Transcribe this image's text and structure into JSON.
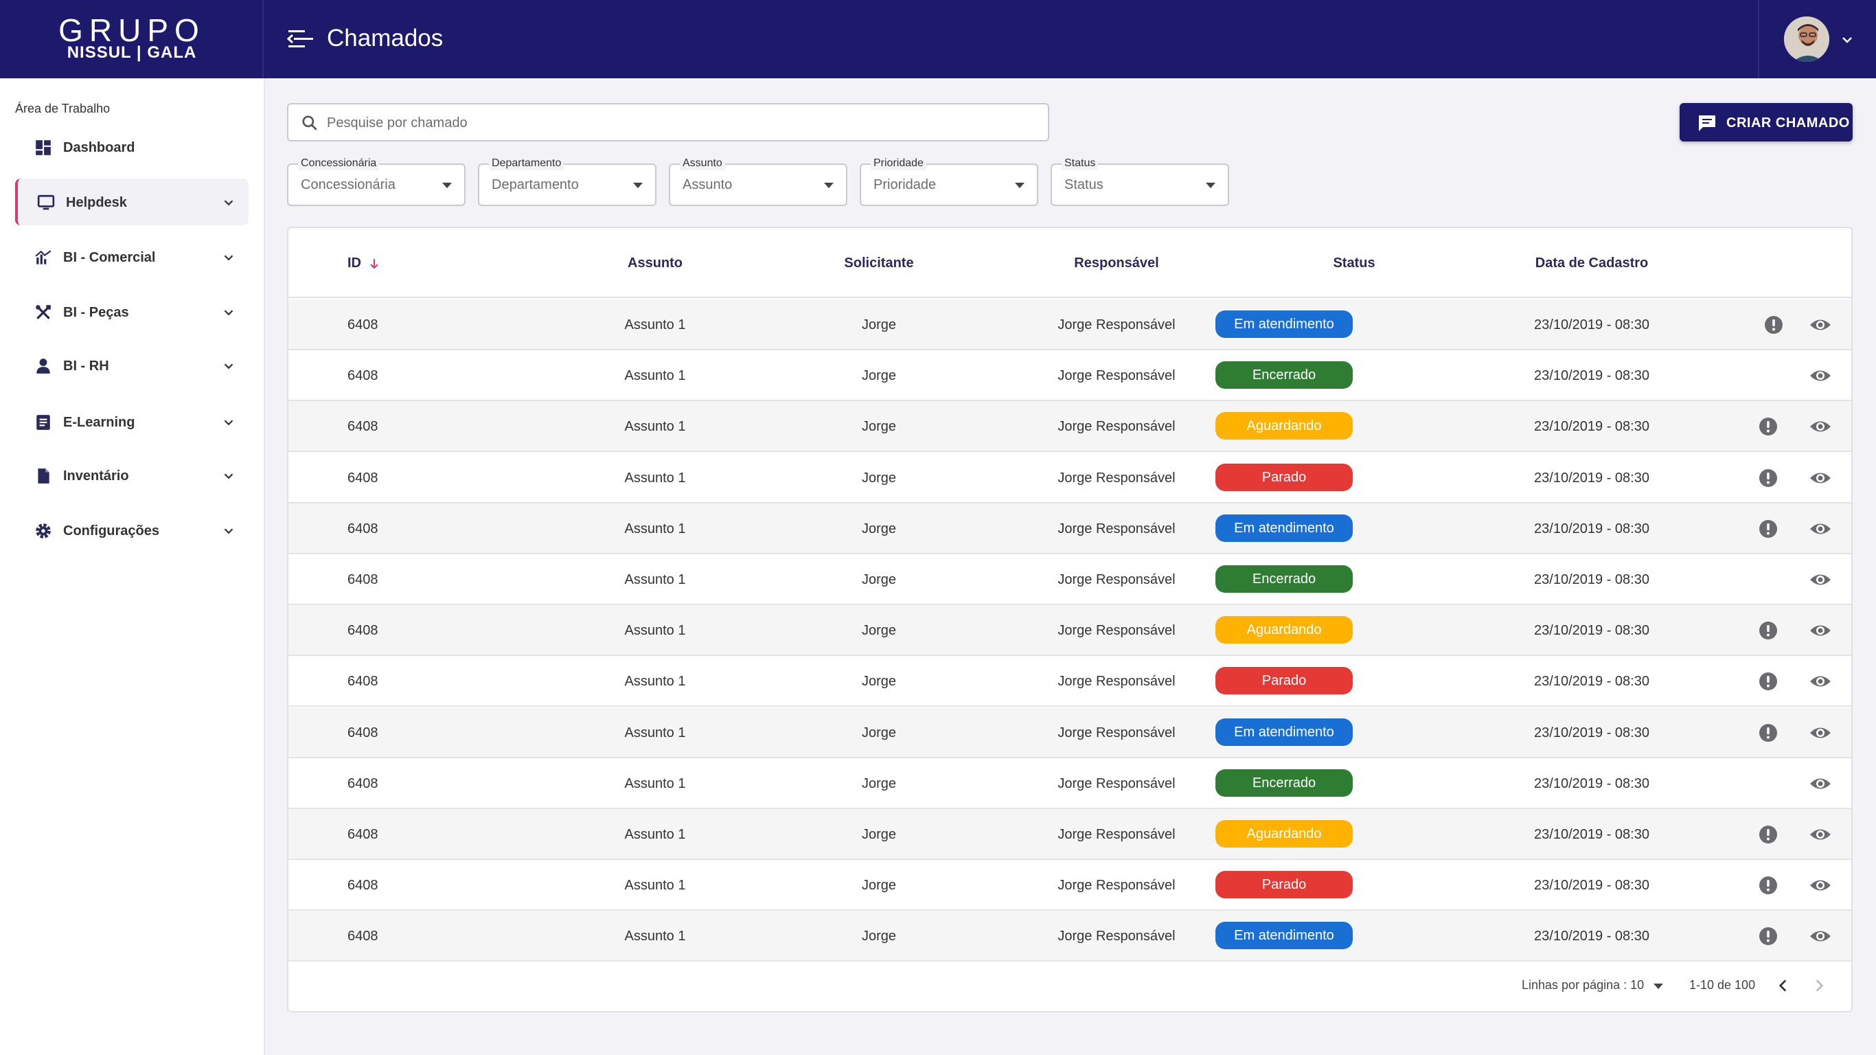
{
  "brand": {
    "line1": "GRUPO",
    "line2": "NISSUL | GALA"
  },
  "header": {
    "title": "Chamados"
  },
  "sidebar": {
    "section": "Área de Trabalho",
    "items": [
      {
        "label": "Dashboard",
        "icon": "dashboard-icon"
      },
      {
        "label": "Helpdesk",
        "icon": "monitor-icon"
      },
      {
        "label": "BI - Comercial",
        "icon": "chart-icon"
      },
      {
        "label": "BI - Peças",
        "icon": "tools-icon"
      },
      {
        "label": "BI - RH",
        "icon": "person-icon"
      },
      {
        "label": "E-Learning",
        "icon": "book-icon"
      },
      {
        "label": "Inventário",
        "icon": "document-icon"
      },
      {
        "label": "Configurações",
        "icon": "gear-icon"
      }
    ]
  },
  "search": {
    "placeholder": "Pesquise por chamado"
  },
  "actions": {
    "create_label": "CRIAR CHAMADO"
  },
  "filters": [
    {
      "label": "Concessionária",
      "value": "Concessionária"
    },
    {
      "label": "Departamento",
      "value": "Departamento"
    },
    {
      "label": "Assunto",
      "value": "Assunto"
    },
    {
      "label": "Prioridade",
      "value": "Prioridade"
    },
    {
      "label": "Status",
      "value": "Status"
    }
  ],
  "table": {
    "columns": [
      "ID",
      "Assunto",
      "Solicitante",
      "Responsável",
      "Status",
      "Data de Cadastro"
    ],
    "rows": [
      {
        "id": "6408",
        "assunto": "Assunto 1",
        "solicitante": "Jorge",
        "responsavel": "Jorge Responsável",
        "status": "Em atendimento",
        "data": "23/10/2019 - 08:30",
        "alert": true
      },
      {
        "id": "6408",
        "assunto": "Assunto 1",
        "solicitante": "Jorge",
        "responsavel": "Jorge Responsável",
        "status": "Encerrado",
        "data": "23/10/2019 - 08:30",
        "alert": false
      },
      {
        "id": "6408",
        "assunto": "Assunto 1",
        "solicitante": "Jorge",
        "responsavel": "Jorge Responsável",
        "status": "Aguardando",
        "data": "23/10/2019 - 08:30",
        "alert": true
      },
      {
        "id": "6408",
        "assunto": "Assunto 1",
        "solicitante": "Jorge",
        "responsavel": "Jorge Responsável",
        "status": "Parado",
        "data": "23/10/2019 - 08:30",
        "alert": true
      },
      {
        "id": "6408",
        "assunto": "Assunto 1",
        "solicitante": "Jorge",
        "responsavel": "Jorge Responsável",
        "status": "Em atendimento",
        "data": "23/10/2019 - 08:30",
        "alert": true
      },
      {
        "id": "6408",
        "assunto": "Assunto 1",
        "solicitante": "Jorge",
        "responsavel": "Jorge Responsável",
        "status": "Encerrado",
        "data": "23/10/2019 - 08:30",
        "alert": false
      },
      {
        "id": "6408",
        "assunto": "Assunto 1",
        "solicitante": "Jorge",
        "responsavel": "Jorge Responsável",
        "status": "Aguardando",
        "data": "23/10/2019 - 08:30",
        "alert": true
      },
      {
        "id": "6408",
        "assunto": "Assunto 1",
        "solicitante": "Jorge",
        "responsavel": "Jorge Responsável",
        "status": "Parado",
        "data": "23/10/2019 - 08:30",
        "alert": true
      },
      {
        "id": "6408",
        "assunto": "Assunto 1",
        "solicitante": "Jorge",
        "responsavel": "Jorge Responsável",
        "status": "Em atendimento",
        "data": "23/10/2019 - 08:30",
        "alert": true
      },
      {
        "id": "6408",
        "assunto": "Assunto 1",
        "solicitante": "Jorge",
        "responsavel": "Jorge Responsável",
        "status": "Encerrado",
        "data": "23/10/2019 - 08:30",
        "alert": false
      },
      {
        "id": "6408",
        "assunto": "Assunto 1",
        "solicitante": "Jorge",
        "responsavel": "Jorge Responsável",
        "status": "Aguardando",
        "data": "23/10/2019 - 08:30",
        "alert": true
      },
      {
        "id": "6408",
        "assunto": "Assunto 1",
        "solicitante": "Jorge",
        "responsavel": "Jorge Responsável",
        "status": "Parado",
        "data": "23/10/2019 - 08:30",
        "alert": true
      },
      {
        "id": "6408",
        "assunto": "Assunto 1",
        "solicitante": "Jorge",
        "responsavel": "Jorge Responsável",
        "status": "Em atendimento",
        "data": "23/10/2019 - 08:30",
        "alert": true
      }
    ]
  },
  "status_colors": {
    "Em atendimento": "#1a6fd4",
    "Encerrado": "#2e7d32",
    "Aguardando": "#ffb300",
    "Parado": "#e53935"
  },
  "pagination": {
    "rows_per_page_label": "Linhas por página : 10",
    "range_label": "1-10 de 100"
  },
  "colors": {
    "brand": "#1d1a6b",
    "accent": "#e1356f"
  }
}
